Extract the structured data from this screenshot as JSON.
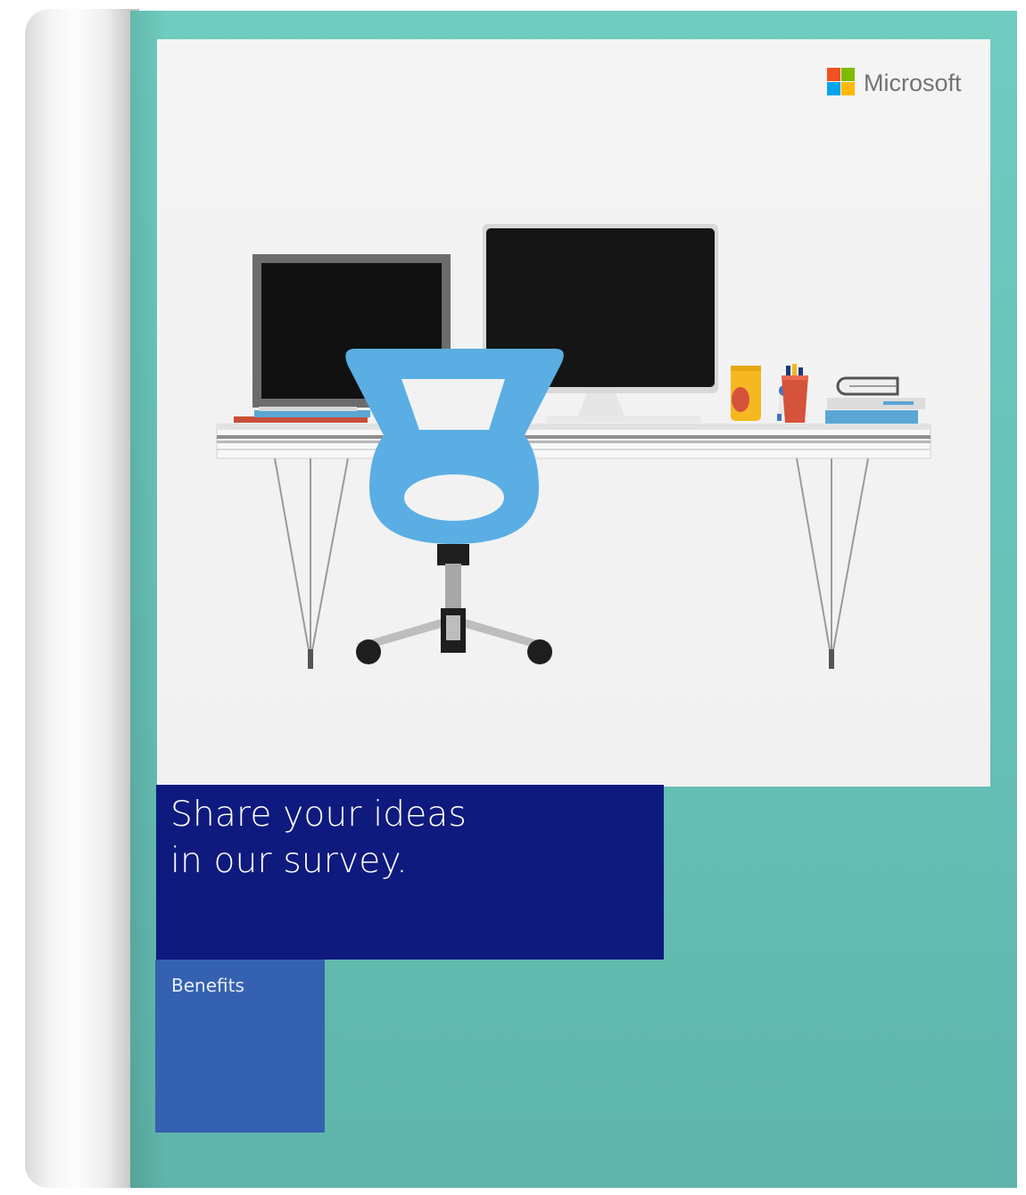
{
  "brand": {
    "name": "Microsoft",
    "logo_colors": [
      "#f25022",
      "#7fba00",
      "#00a4ef",
      "#ffb900"
    ]
  },
  "headline": {
    "line1": "Share your ideas",
    "line2": "in our survey."
  },
  "section_label": "Benefits",
  "colors": {
    "cover": "#6fccbf",
    "panel": "#f3f3f3",
    "headline_box": "#0f1a7e",
    "benefits_box": "#3561b1",
    "chair": "#5aaee3"
  },
  "illustration": {
    "objects": [
      "desk",
      "small-monitor",
      "large-monitor",
      "office-chair",
      "cup",
      "pencil-holder",
      "figurine",
      "book-stack"
    ]
  }
}
